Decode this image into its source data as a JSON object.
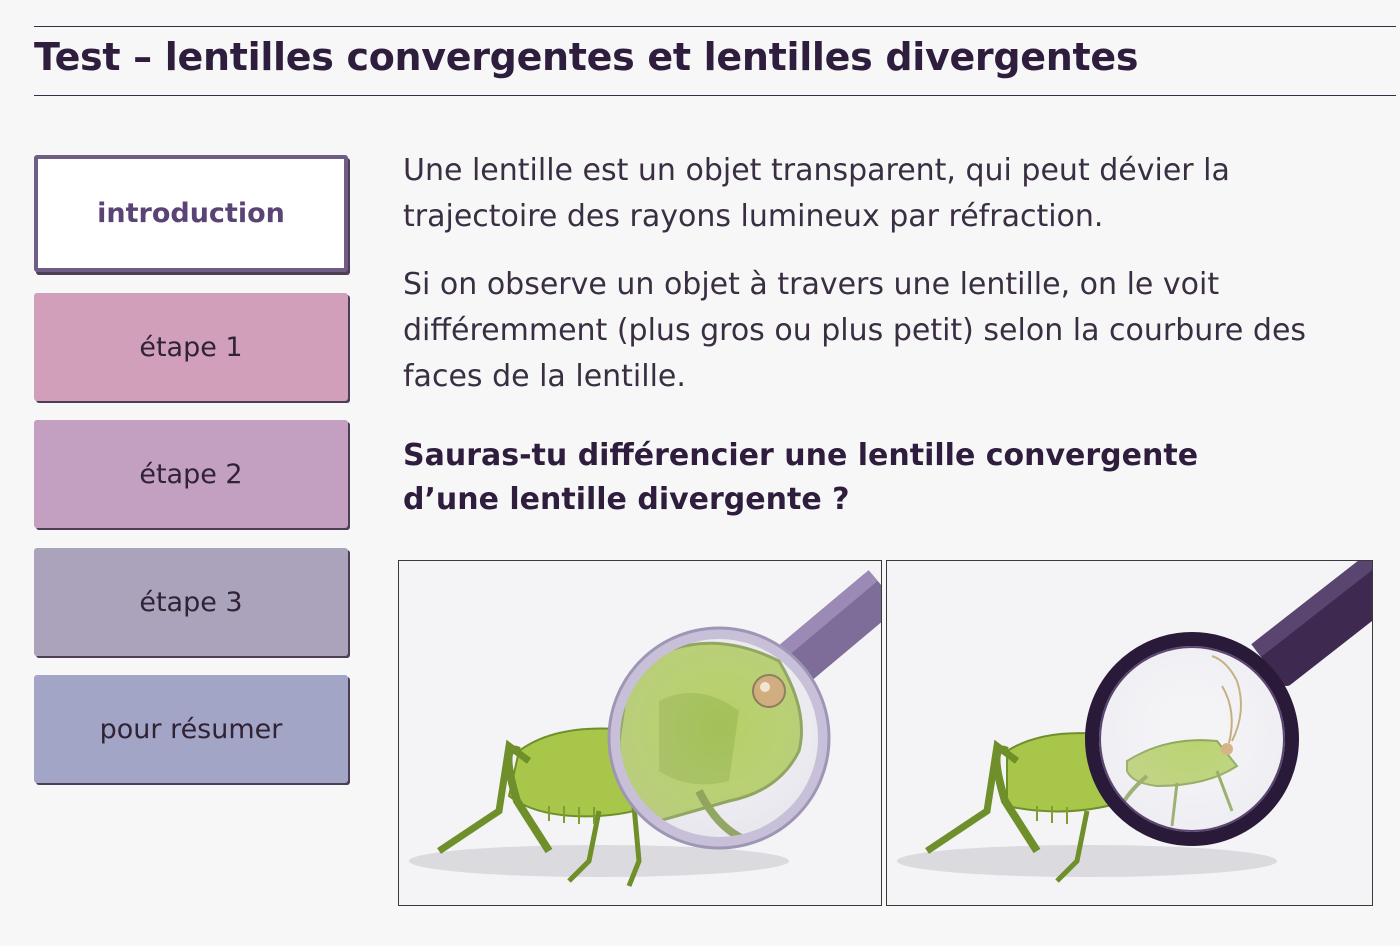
{
  "header": {
    "title": "Test – lentilles convergentes et lentilles divergentes"
  },
  "nav": {
    "items": [
      {
        "label": "introduction"
      },
      {
        "label": "étape 1"
      },
      {
        "label": "étape 2"
      },
      {
        "label": "étape 3"
      },
      {
        "label": "pour résumer"
      }
    ]
  },
  "content": {
    "paragraph1": "Une lentille est un objet transparent, qui peut dévier la trajectoire des rayons lumineux par réfraction.",
    "paragraph2": "Si on observe un objet à travers une lentille, on le voit différemment (plus gros ou plus petit) selon la courbure des faces de la lentille.",
    "question": "Sauras-tu différencier une lentille convergente d’une lentille divergente ?"
  },
  "colors": {
    "title": "#2e1d3d",
    "nav_active_border": "#6f5d86",
    "nav_step1": "#d29fbb",
    "nav_step2": "#c39fc1",
    "nav_step3": "#aba3bc",
    "nav_summary": "#a3a5c6",
    "grasshopper": "#a8c74a"
  },
  "images": [
    {
      "subject": "grasshopper-magnified-icon"
    },
    {
      "subject": "grasshopper-reduced-icon"
    }
  ]
}
